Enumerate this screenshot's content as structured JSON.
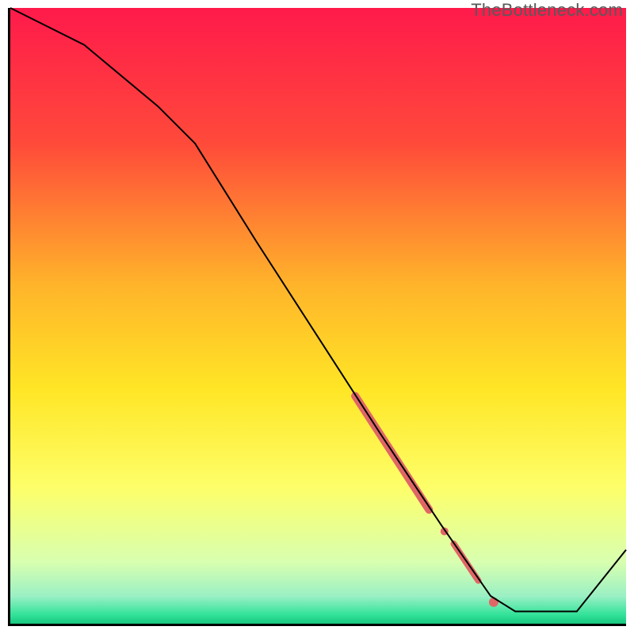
{
  "watermark": "TheBottleneck.com",
  "chart_data": {
    "type": "line",
    "title": "",
    "xlabel": "",
    "ylabel": "",
    "xlim": [
      0,
      100
    ],
    "ylim": [
      0,
      100
    ],
    "grid": false,
    "legend": false,
    "gradient_stops": [
      {
        "pos": 0.0,
        "color": "#ff1a4b"
      },
      {
        "pos": 0.22,
        "color": "#ff4a3a"
      },
      {
        "pos": 0.45,
        "color": "#ffb42a"
      },
      {
        "pos": 0.62,
        "color": "#ffe626"
      },
      {
        "pos": 0.78,
        "color": "#fdff6a"
      },
      {
        "pos": 0.9,
        "color": "#d8ffb0"
      },
      {
        "pos": 0.955,
        "color": "#9bf0c4"
      },
      {
        "pos": 0.985,
        "color": "#34e39a"
      },
      {
        "pos": 1.0,
        "color": "#18c77e"
      }
    ],
    "series": [
      {
        "name": "main-curve",
        "color": "#000000",
        "width": 2,
        "x": [
          0,
          12,
          24,
          30,
          40,
          50,
          60,
          70,
          78,
          82,
          88,
          92,
          100
        ],
        "y": [
          100,
          94,
          84,
          78,
          62,
          46.5,
          31,
          16,
          4.5,
          2,
          2,
          2,
          12
        ]
      }
    ],
    "markers": [
      {
        "name": "thick-segment-1",
        "shape": "segment",
        "color": "#e06666",
        "width": 10,
        "x1": 56,
        "y1": 37,
        "x2": 68,
        "y2": 18.5
      },
      {
        "name": "dot-mid",
        "shape": "circle",
        "color": "#e06666",
        "r": 5,
        "x": 70.5,
        "y": 15
      },
      {
        "name": "thick-segment-2",
        "shape": "segment",
        "color": "#e06666",
        "width": 8,
        "x1": 72,
        "y1": 13,
        "x2": 76,
        "y2": 7
      },
      {
        "name": "dot-bottom",
        "shape": "circle",
        "color": "#e06666",
        "r": 6,
        "x": 78.5,
        "y": 3.5
      }
    ]
  }
}
